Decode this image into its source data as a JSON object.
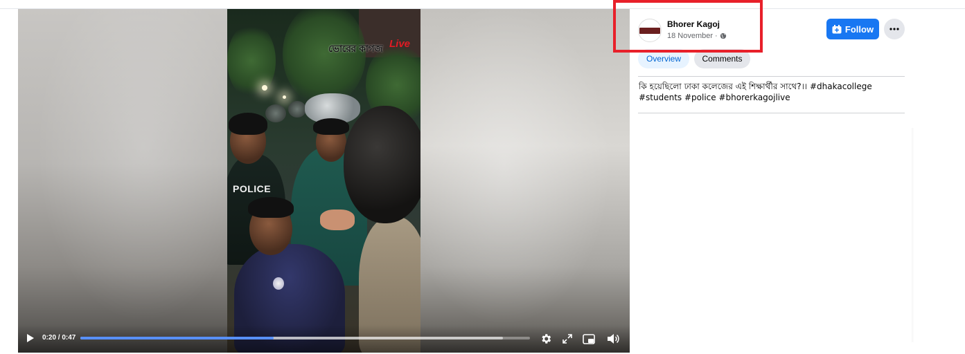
{
  "video": {
    "watermark": "ভোরের কাগজ",
    "watermark_live": "Live",
    "vest_text": "POLICE",
    "time_display": "0:20 / 0:47",
    "progress_fraction": 0.43,
    "buffer_fraction": 0.94
  },
  "post": {
    "author": "Bhorer Kagoj",
    "date": "18 November",
    "date_separator": "·",
    "follow_label": "Follow",
    "tabs": [
      {
        "label": "Overview",
        "active": true
      },
      {
        "label": "Comments",
        "active": false
      }
    ],
    "caption_text": "কি হয়েছিলো ঢাকা কলেজের এই শিক্ষার্থীর সাথে?।। ",
    "hashtags": "#dhakacollege #students #police #bhorerkagojlive"
  },
  "colors": {
    "accent": "#1877f2",
    "progress": "#5890ff",
    "highlight": "#e8202a"
  },
  "icons": [
    "play-icon",
    "settings-icon",
    "expand-icon",
    "pip-icon",
    "volume-icon",
    "globe-icon",
    "follow-plus-icon",
    "more-icon"
  ]
}
